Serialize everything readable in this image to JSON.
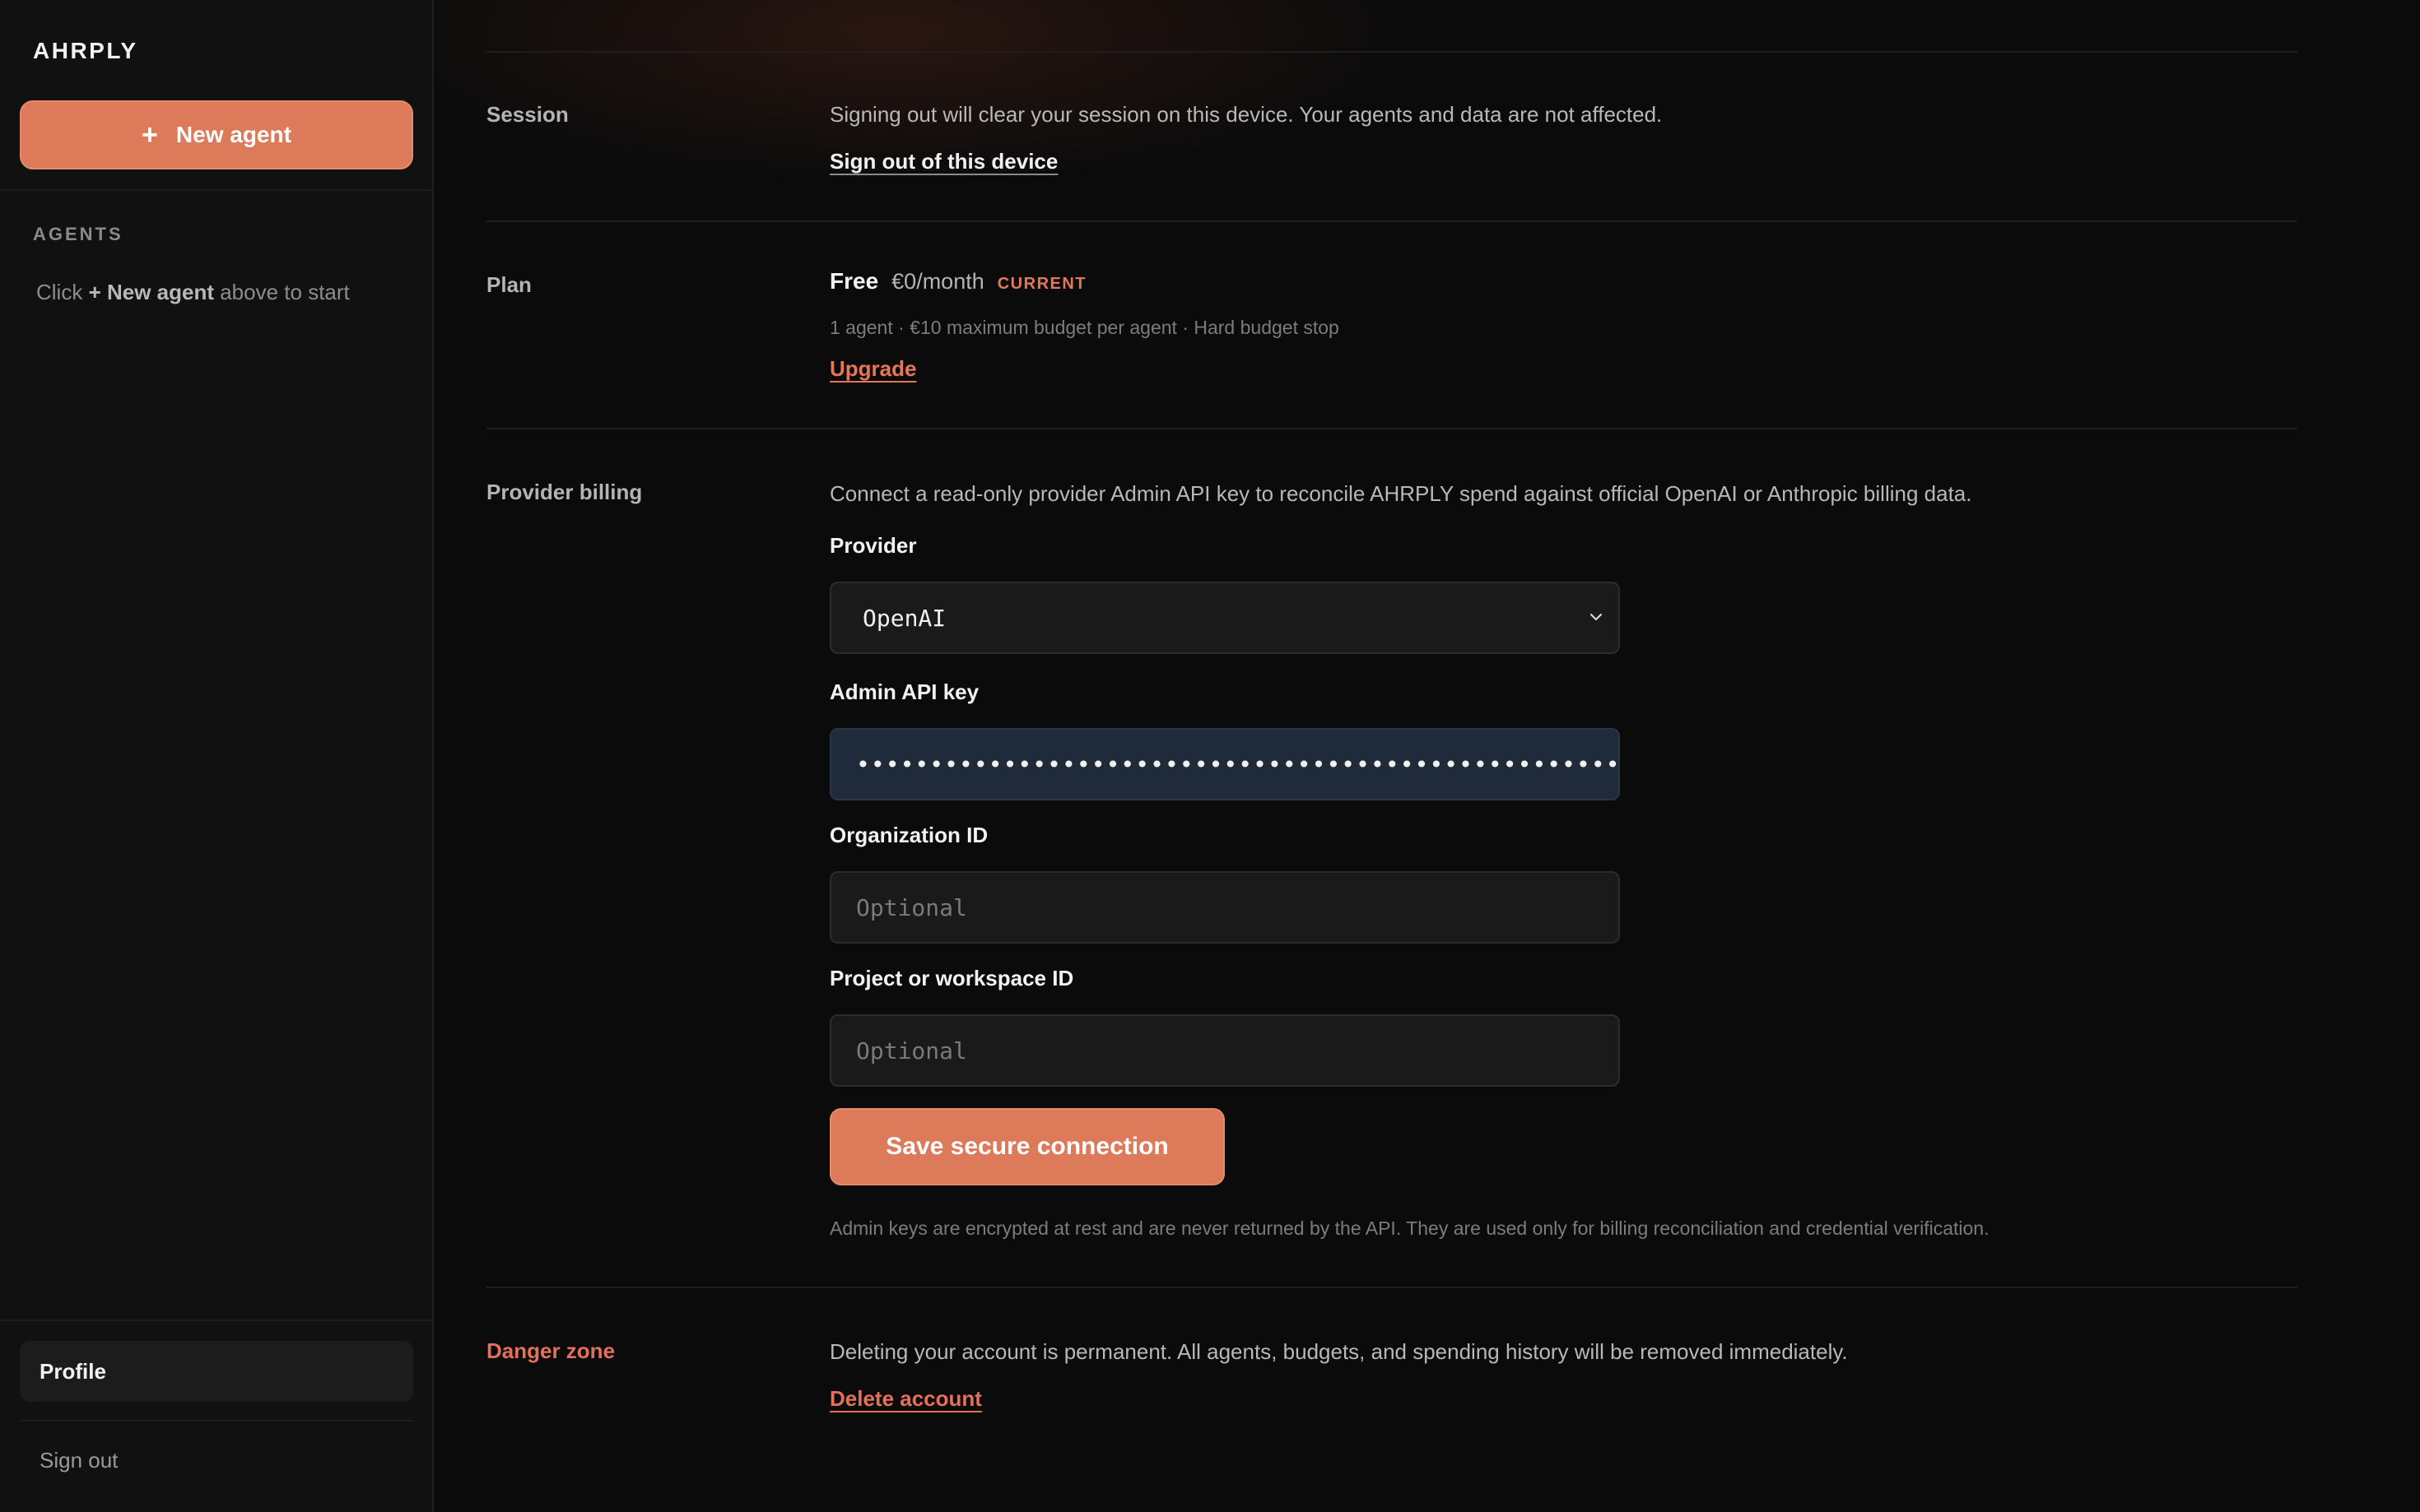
{
  "sidebar": {
    "brand": "AHRPLY",
    "new_agent_label": "New agent",
    "agents_heading": "AGENTS",
    "empty_prefix": "Click ",
    "empty_bold": "+ New agent",
    "empty_suffix": " above to start",
    "profile_label": "Profile",
    "signout_label": "Sign out"
  },
  "session": {
    "label": "Session",
    "description": "Signing out will clear your session on this device. Your agents and data are not affected.",
    "action": "Sign out of this device"
  },
  "plan": {
    "label": "Plan",
    "name": "Free",
    "price": "€0/month",
    "badge": "CURRENT",
    "details": "1 agent · €10 maximum budget per agent · Hard budget stop",
    "action": "Upgrade"
  },
  "provider_billing": {
    "label": "Provider billing",
    "description": "Connect a read-only provider Admin API key to reconcile AHRPLY spend against official OpenAI or Anthropic billing data.",
    "provider_label": "Provider",
    "provider_value": "OpenAI",
    "api_key_label": "Admin API key",
    "api_key_value": "••••••••••••••••••••••••••••••••••••••••••••••••••••",
    "org_label": "Organization ID",
    "org_placeholder": "Optional",
    "project_label": "Project or workspace ID",
    "project_placeholder": "Optional",
    "save_label": "Save secure connection",
    "note": "Admin keys are encrypted at rest and are never returned by the API. They are used only for billing reconciliation and credential verification."
  },
  "danger": {
    "label": "Danger zone",
    "description": "Deleting your account is permanent. All agents, budgets, and spending history will be removed immediately.",
    "action": "Delete account"
  },
  "colors": {
    "accent": "#dc7a5a",
    "danger": "#e46f5a",
    "background": "#0b0b0b",
    "sidebar": "#111111"
  }
}
